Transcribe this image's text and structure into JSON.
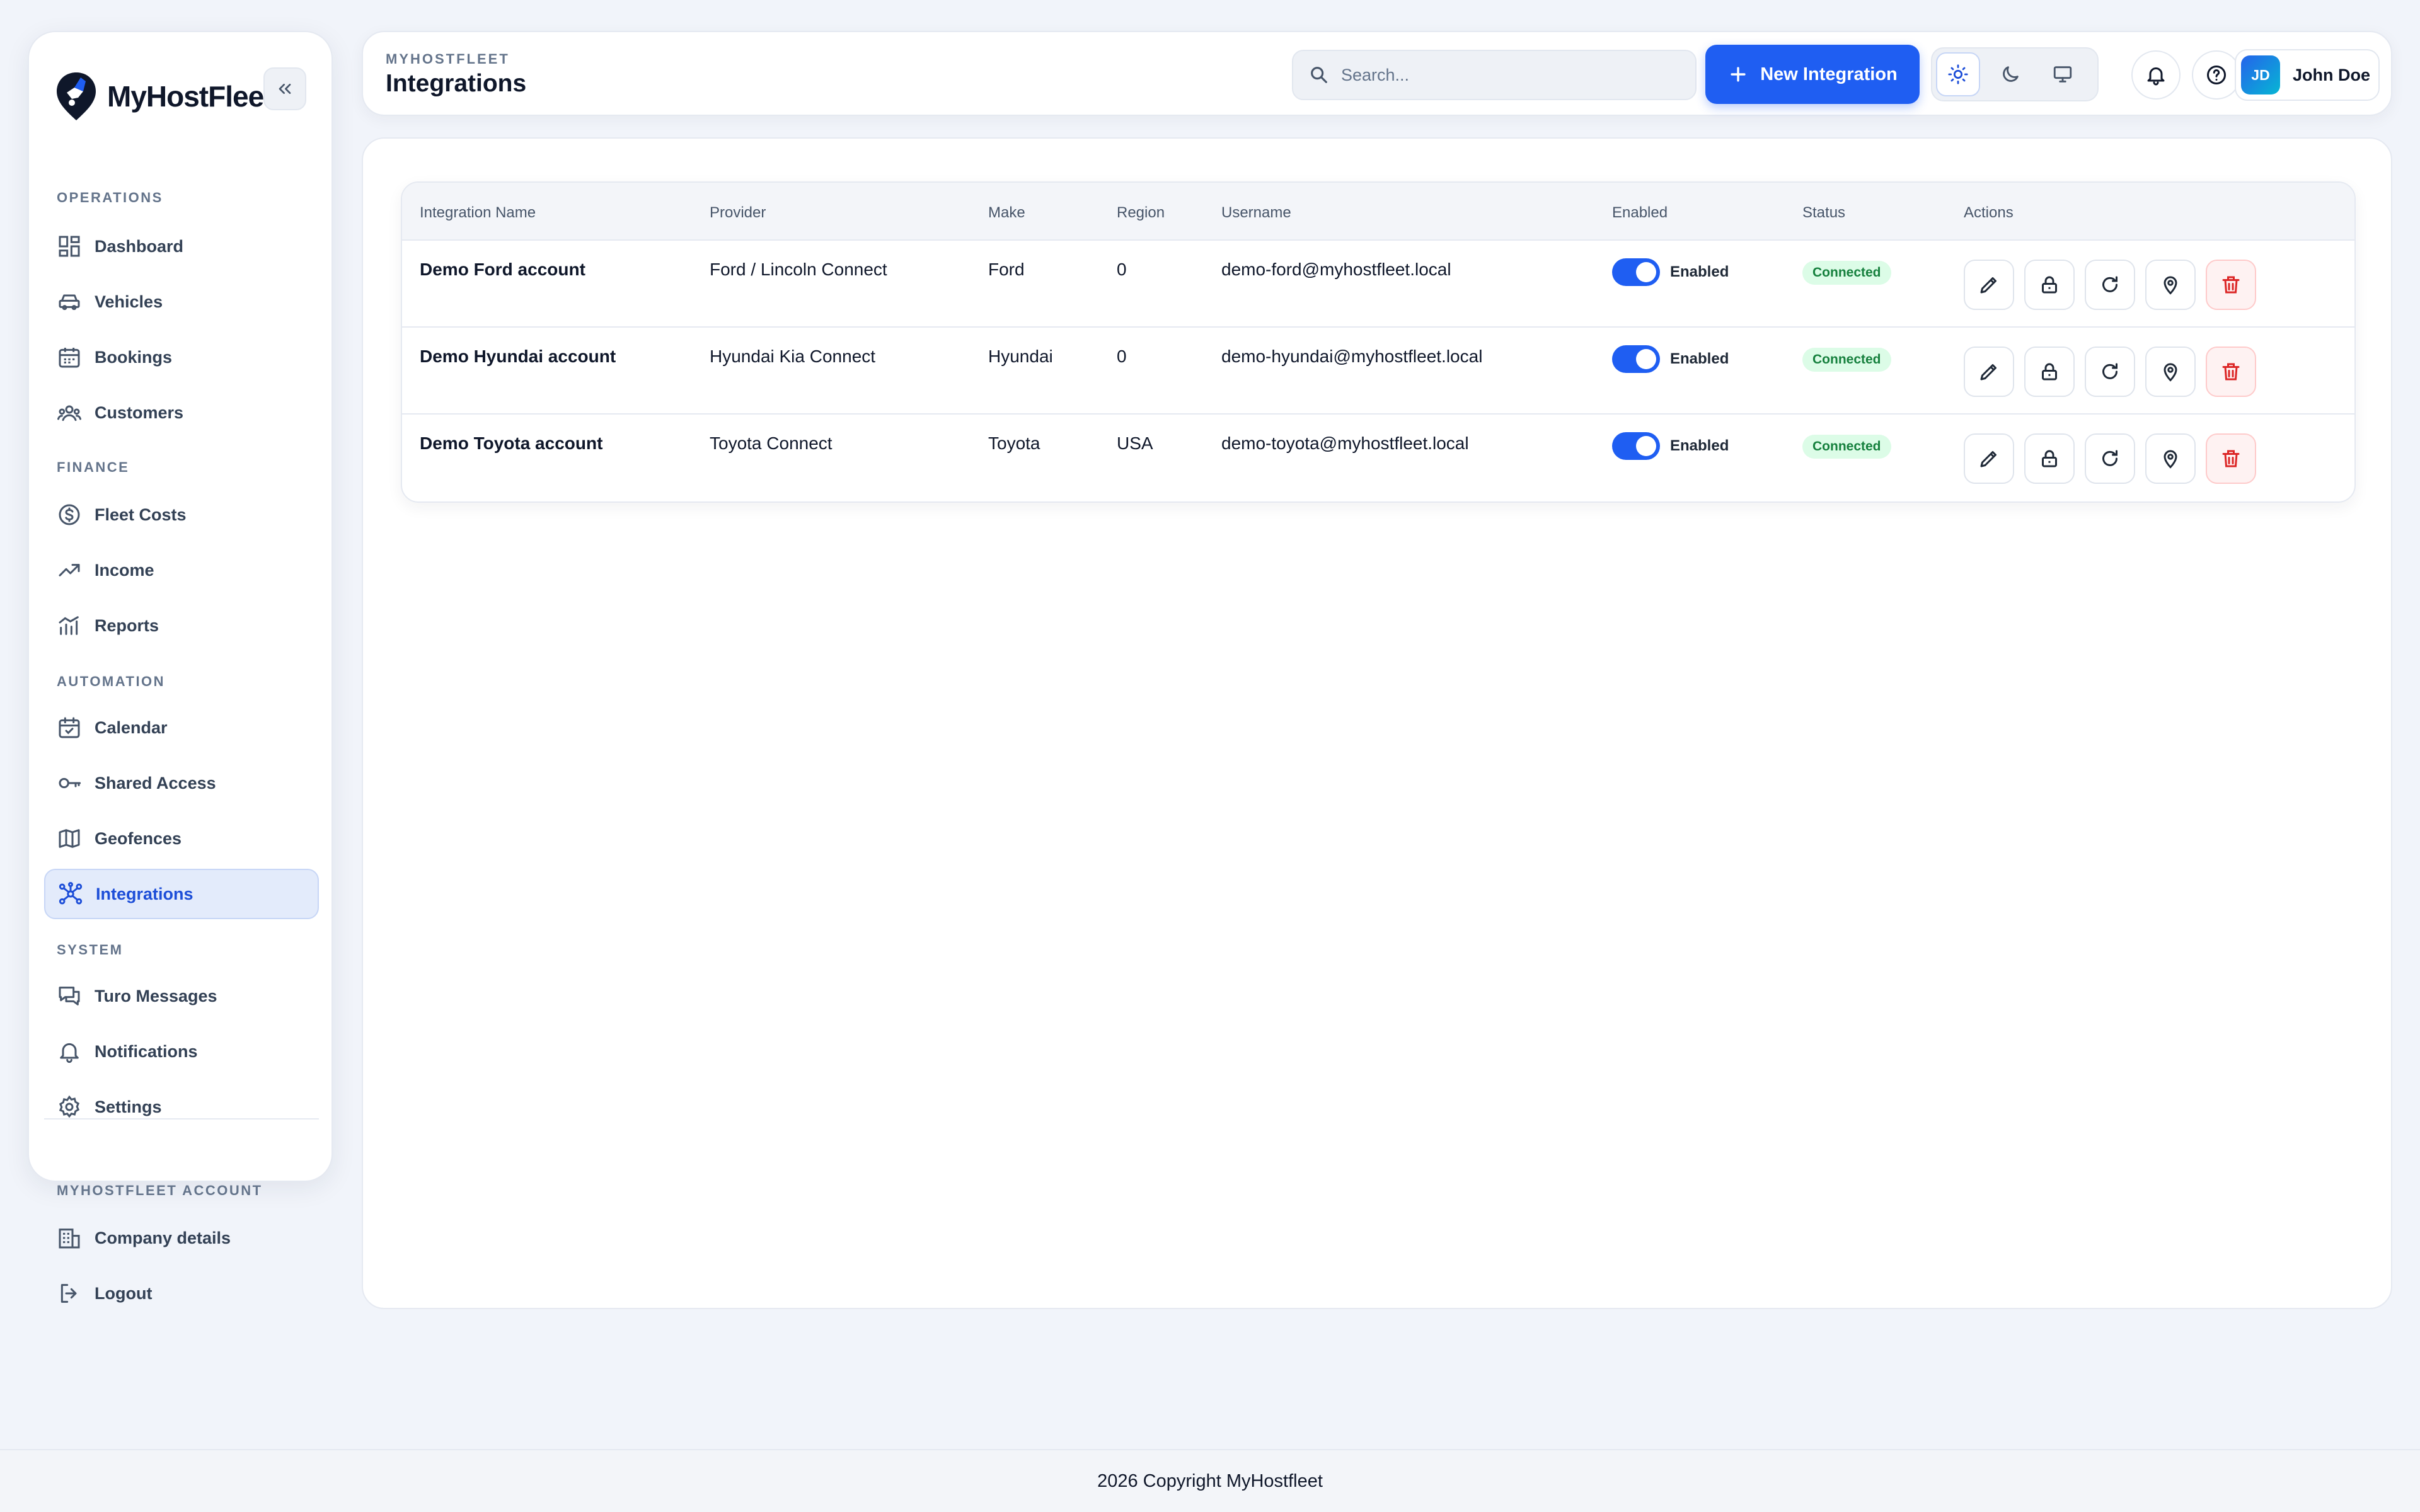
{
  "brand": {
    "name": "MyHostFleet"
  },
  "sidebar": {
    "sections": {
      "operations": "OPERATIONS",
      "finance": "FINANCE",
      "automation": "AUTOMATION",
      "system": "SYSTEM",
      "account": "MYHOSTFLEET ACCOUNT"
    },
    "items": {
      "dashboard": "Dashboard",
      "vehicles": "Vehicles",
      "bookings": "Bookings",
      "customers": "Customers",
      "fleet_costs": "Fleet Costs",
      "income": "Income",
      "reports": "Reports",
      "calendar": "Calendar",
      "shared_access": "Shared Access",
      "geofences": "Geofences",
      "integrations": "Integrations",
      "turo_messages": "Turo Messages",
      "notifications": "Notifications",
      "settings": "Settings",
      "company_details": "Company details",
      "logout": "Logout"
    },
    "active": "integrations"
  },
  "header": {
    "eyebrow": "MYHOSTFLEET",
    "title": "Integrations",
    "search_placeholder": "Search...",
    "new_button": "New Integration",
    "user": {
      "initials": "JD",
      "name": "John Doe"
    }
  },
  "table": {
    "columns": [
      "Integration Name",
      "Provider",
      "Make",
      "Region",
      "Username",
      "Enabled",
      "Status",
      "Actions"
    ],
    "rows": [
      {
        "name": "Demo Ford account",
        "provider": "Ford / Lincoln Connect",
        "make": "Ford",
        "region": "0",
        "username": "demo-ford@myhostfleet.local",
        "enabled": "Enabled",
        "status": "Connected"
      },
      {
        "name": "Demo Hyundai account",
        "provider": "Hyundai Kia Connect",
        "make": "Hyundai",
        "region": "0",
        "username": "demo-hyundai@myhostfleet.local",
        "enabled": "Enabled",
        "status": "Connected"
      },
      {
        "name": "Demo Toyota account",
        "provider": "Toyota Connect",
        "make": "Toyota",
        "region": "USA",
        "username": "demo-toyota@myhostfleet.local",
        "enabled": "Enabled",
        "status": "Connected"
      }
    ]
  },
  "footer": {
    "text": "2026 Copyright MyHostfleet"
  },
  "colors": {
    "accent": "#1f5ef2",
    "success_bg": "#dcfce7",
    "success_text": "#15803d",
    "danger": "#dc2626"
  }
}
